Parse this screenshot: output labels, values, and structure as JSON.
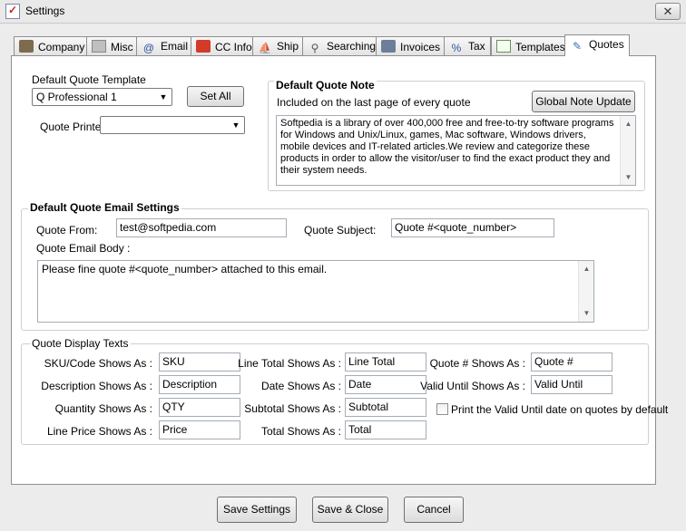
{
  "window": {
    "title": "Settings",
    "close_glyph": "✕"
  },
  "tabs": [
    {
      "label": "Company",
      "icon": "company-icon"
    },
    {
      "label": "Misc",
      "icon": "misc-icon"
    },
    {
      "label": "Email",
      "icon": "email-icon"
    },
    {
      "label": "CC Info",
      "icon": "cc-info-icon"
    },
    {
      "label": "Ship",
      "icon": "ship-icon"
    },
    {
      "label": "Searching",
      "icon": "searching-icon"
    },
    {
      "label": "Invoices",
      "icon": "invoices-icon"
    },
    {
      "label": "Tax",
      "icon": "tax-icon"
    },
    {
      "label": "Templates",
      "icon": "templates-icon"
    },
    {
      "label": "Quotes",
      "icon": "quotes-icon",
      "active": true
    }
  ],
  "template": {
    "label": "Default Quote Template",
    "value": "Q Professional 1",
    "set_all": "Set All",
    "printer_label": "Quote Printer",
    "printer_value": ""
  },
  "note": {
    "title": "Default Quote Note",
    "subtitle": "Included on the last page of every quote",
    "global_button": "Global Note Update",
    "body": "Softpedia is a library of over 400,000 free and free-to-try software programs for Windows and Unix/Linux, games, Mac software, Windows drivers, mobile devices and IT-related articles.We review and categorize these products in order to allow the visitor/user to find the exact product they and their system needs."
  },
  "email": {
    "title": "Default Quote Email Settings",
    "from_label": "Quote From:",
    "from_value": "test@softpedia.com",
    "subject_label": "Quote Subject:",
    "subject_value": "Quote #<quote_number>",
    "body_label": "Quote Email Body :",
    "body_value": "Please fine quote #<quote_number> attached to this email."
  },
  "display": {
    "title": "Quote Display Texts",
    "col1": [
      {
        "label": "SKU/Code Shows As :",
        "value": "SKU"
      },
      {
        "label": "Description Shows As :",
        "value": "Description"
      },
      {
        "label": "Quantity Shows As :",
        "value": "QTY"
      },
      {
        "label": "Line Price Shows As :",
        "value": "Price"
      }
    ],
    "col2": [
      {
        "label": "Line Total Shows As :",
        "value": "Line Total"
      },
      {
        "label": "Date Shows As :",
        "value": "Date"
      },
      {
        "label": "Subtotal Shows As :",
        "value": "Subtotal"
      },
      {
        "label": "Total Shows As :",
        "value": "Total"
      }
    ],
    "col3": [
      {
        "label": "Quote # Shows As :",
        "value": "Quote #"
      },
      {
        "label": "Valid Until Shows As :",
        "value": "Valid Until"
      }
    ],
    "valid_until_checkbox": "Print the Valid Until date on quotes by default"
  },
  "buttons": {
    "save": "Save Settings",
    "save_close": "Save & Close",
    "cancel": "Cancel"
  }
}
